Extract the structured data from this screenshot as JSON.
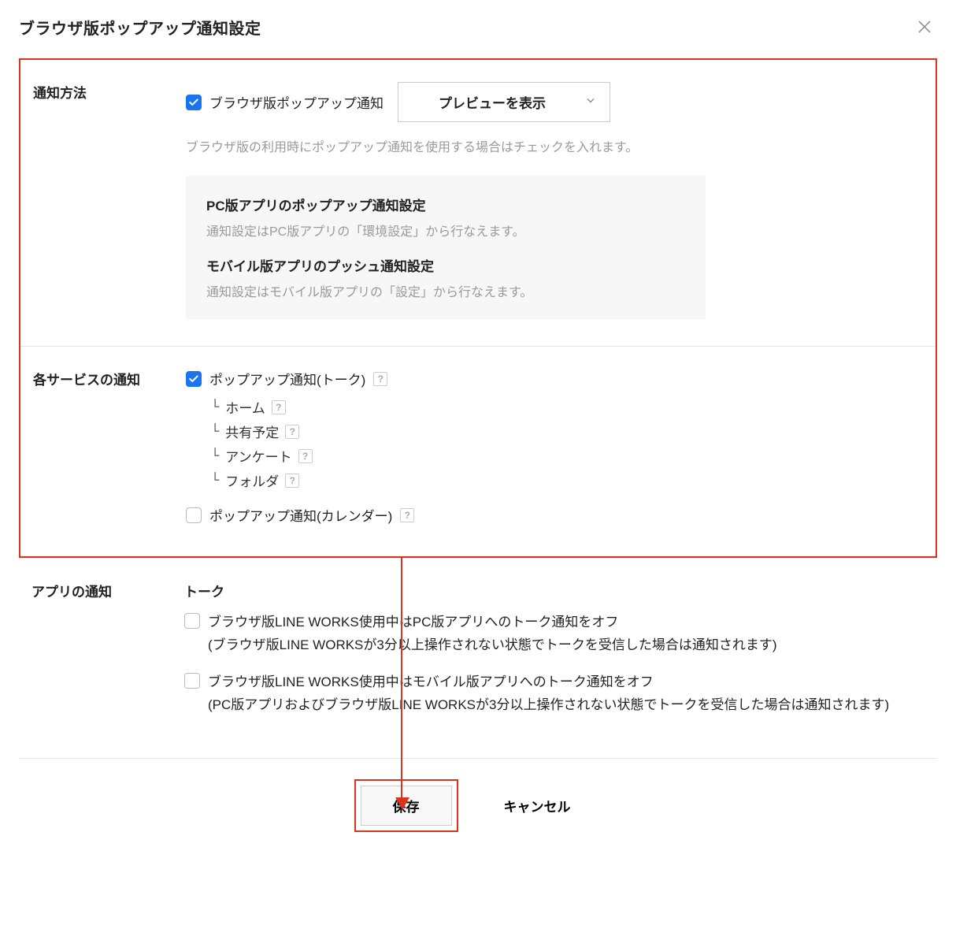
{
  "header": {
    "title": "ブラウザ版ポップアップ通知設定"
  },
  "notification_method": {
    "label": "通知方法",
    "checkbox_label": "ブラウザ版ポップアップ通知",
    "dropdown_label": "プレビューを表示",
    "helper": "ブラウザ版の利用時にポップアップ通知を使用する場合はチェックを入れます。",
    "info": {
      "pc_title": "PC版アプリのポップアップ通知設定",
      "pc_text": "通知設定はPC版アプリの「環境設定」から行なえます。",
      "mobile_title": "モバイル版アプリのプッシュ通知設定",
      "mobile_text": "通知設定はモバイル版アプリの「設定」から行なえます。"
    }
  },
  "service_notifications": {
    "label": "各サービスの通知",
    "popup_talk": "ポップアップ通知(トーク)",
    "sub_home": "ホーム",
    "sub_shared": "共有予定",
    "sub_survey": "アンケート",
    "sub_folder": "フォルダ",
    "popup_calendar": "ポップアップ通知(カレンダー)"
  },
  "app_notifications": {
    "label": "アプリの通知",
    "talk_title": "トーク",
    "pc_off_label": "ブラウザ版LINE WORKS使用中はPC版アプリへのトーク通知をオフ",
    "pc_off_note": "(ブラウザ版LINE WORKSが3分以上操作されない状態でトークを受信した場合は通知されます)",
    "mobile_off_label": "ブラウザ版LINE WORKS使用中はモバイル版アプリへのトーク通知をオフ",
    "mobile_off_note": "(PC版アプリおよびブラウザ版LINE WORKSが3分以上操作されない状態でトークを受信した場合は通知されます)"
  },
  "footer": {
    "save": "保存",
    "cancel": "キャンセル"
  }
}
